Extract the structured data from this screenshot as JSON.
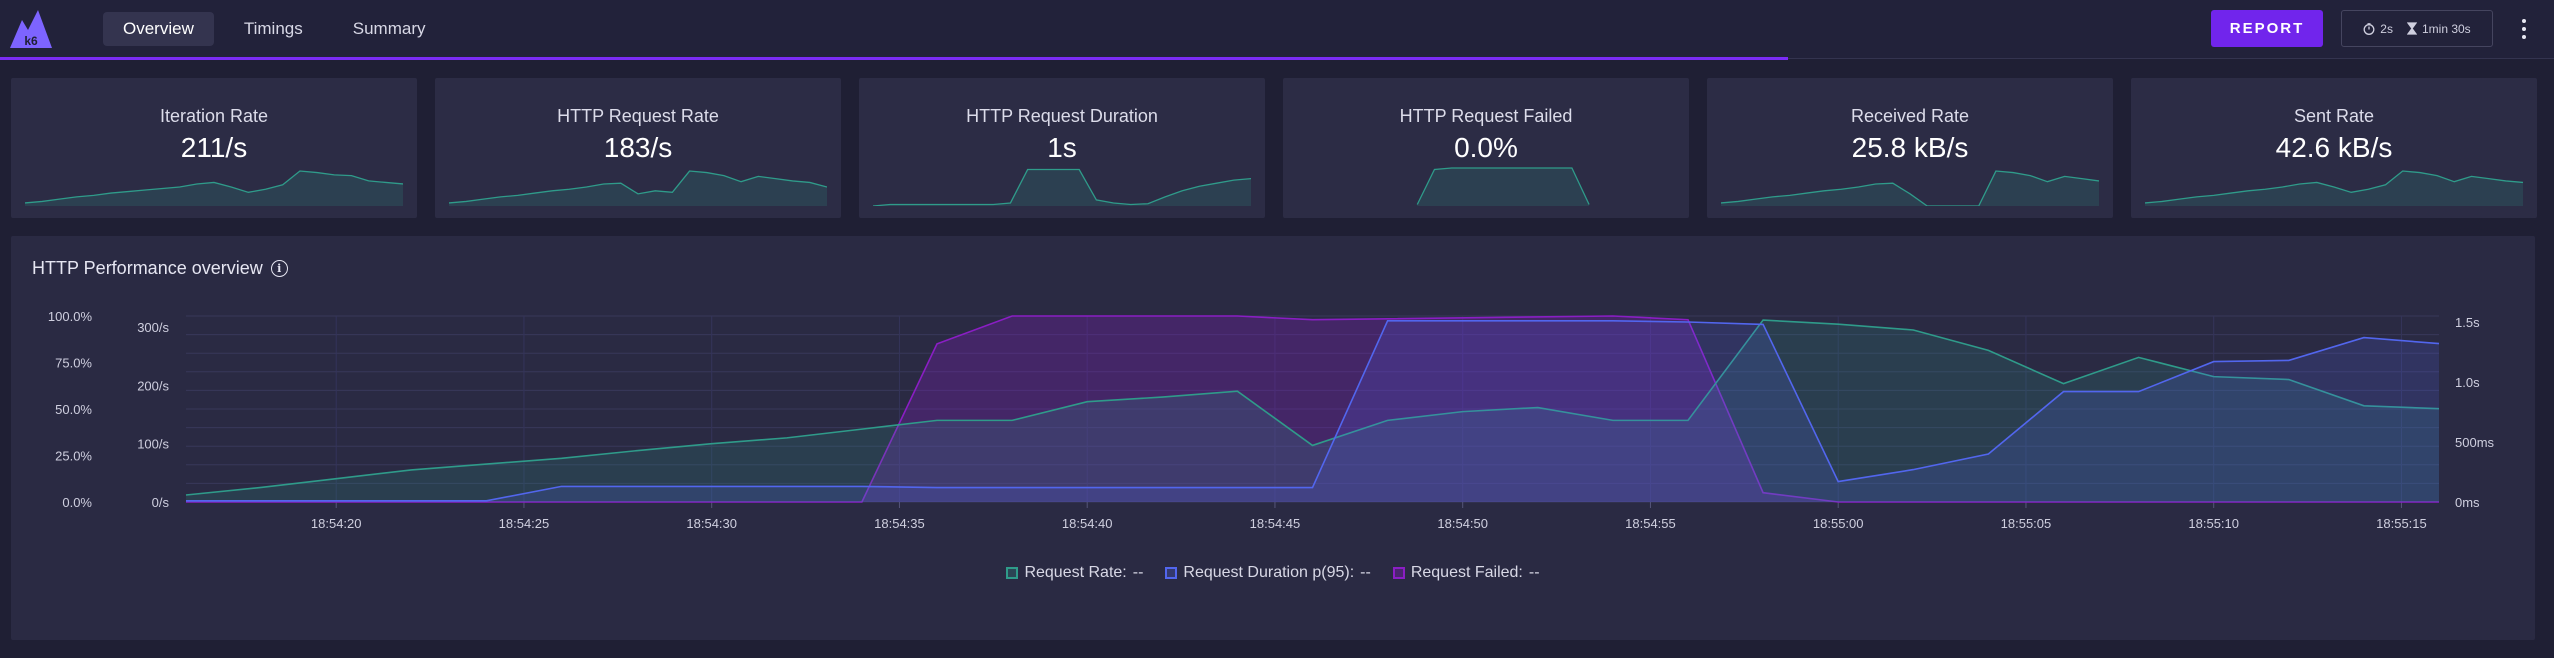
{
  "header": {
    "logo_text": "k6",
    "tabs": [
      {
        "label": "Overview",
        "active": true
      },
      {
        "label": "Timings",
        "active": false
      },
      {
        "label": "Summary",
        "active": false
      }
    ],
    "report_label": "REPORT",
    "timer": {
      "period": "2s",
      "duration": "1min 30s"
    },
    "progress_fraction": 0.7
  },
  "colors": {
    "accent": "#7125ec",
    "rate": "#2f9b8a",
    "duration": "#5266ee",
    "failed": "#8a1ec4"
  },
  "cards": [
    {
      "title": "Iteration Rate",
      "value": "211/s",
      "spark": [
        4,
        6,
        9,
        12,
        14,
        17,
        19,
        21,
        23,
        25,
        29,
        31,
        25,
        18,
        22,
        28,
        46,
        44,
        41,
        40,
        33,
        31,
        29
      ]
    },
    {
      "title": "HTTP Request Rate",
      "value": "183/s",
      "spark": [
        4,
        6,
        9,
        12,
        14,
        17,
        20,
        22,
        25,
        29,
        30,
        16,
        20,
        18,
        46,
        44,
        40,
        32,
        39,
        36,
        33,
        31,
        25
      ]
    },
    {
      "title": "HTTP Request Duration",
      "value": "1s",
      "spark": [
        0,
        2,
        2,
        2,
        2,
        2,
        2,
        2,
        4,
        48,
        48,
        48,
        48,
        8,
        4,
        2,
        3,
        12,
        20,
        26,
        30,
        34,
        36
      ]
    },
    {
      "title": "HTTP Request Failed",
      "value": "0.0%",
      "spark": [
        null,
        null,
        null,
        null,
        null,
        null,
        null,
        2,
        48,
        50,
        50,
        50,
        50,
        50,
        50,
        50,
        50,
        2,
        null,
        null,
        null,
        null,
        null
      ]
    },
    {
      "title": "Received Rate",
      "value": "25.8 kB/s",
      "spark": [
        4,
        6,
        9,
        12,
        14,
        17,
        20,
        22,
        25,
        29,
        30,
        16,
        0,
        0,
        0,
        0,
        46,
        44,
        40,
        32,
        39,
        36,
        33
      ]
    },
    {
      "title": "Sent Rate",
      "value": "42.6 kB/s",
      "spark": [
        4,
        6,
        9,
        12,
        14,
        17,
        20,
        22,
        25,
        29,
        31,
        25,
        18,
        22,
        28,
        46,
        44,
        40,
        32,
        39,
        36,
        33,
        31
      ]
    }
  ],
  "panel": {
    "title": "HTTP Performance overview",
    "legend": [
      {
        "label": "Request Rate:",
        "value": "--"
      },
      {
        "label": "Request Duration p(95):",
        "value": "--"
      },
      {
        "label": "Request Failed:",
        "value": "--"
      }
    ]
  },
  "chart_data": {
    "type": "area",
    "x_tick_labels": [
      "18:54:20",
      "18:54:25",
      "18:54:30",
      "18:54:35",
      "18:54:40",
      "18:54:45",
      "18:54:50",
      "18:54:55",
      "18:55:00",
      "18:55:05",
      "18:55:10",
      "18:55:15"
    ],
    "x_range_seconds": [
      0,
      60
    ],
    "x_ticks_seconds": [
      4,
      9,
      14,
      19,
      24,
      29,
      34,
      39,
      44,
      49,
      54,
      59
    ],
    "axes": {
      "failed_percent": {
        "ticks": [
          "0.0%",
          "25.0%",
          "50.0%",
          "75.0%",
          "100.0%"
        ],
        "range": [
          0,
          100
        ]
      },
      "rate_per_s": {
        "ticks": [
          "0/s",
          "100/s",
          "200/s",
          "300/s"
        ],
        "range": [
          0,
          319
        ]
      },
      "duration_ms": {
        "ticks": [
          "0ms",
          "500ms",
          "1.0s",
          "1.5s"
        ],
        "range": [
          0,
          1550
        ]
      }
    },
    "series": [
      {
        "name": "Request Rate",
        "axis": "rate_per_s",
        "x": [
          0,
          2,
          4,
          6,
          8,
          10,
          12,
          14,
          16,
          18,
          20,
          22,
          24,
          26,
          28,
          30,
          32,
          34,
          36,
          38,
          40,
          42,
          44,
          46,
          48,
          50,
          52,
          54,
          56,
          58,
          60
        ],
        "values": [
          12,
          25,
          40,
          55,
          65,
          75,
          88,
          100,
          110,
          125,
          140,
          140,
          172,
          180,
          190,
          97,
          140,
          155,
          162,
          140,
          140,
          312,
          305,
          295,
          260,
          203,
          248,
          215,
          210,
          165,
          160
        ]
      },
      {
        "name": "Request Duration p(95)",
        "axis": "duration_ms",
        "x": [
          0,
          8,
          10,
          18,
          20,
          28,
          30,
          32,
          38,
          40,
          42,
          44,
          46,
          48,
          50,
          52,
          54,
          56,
          58,
          60
        ],
        "values": [
          10,
          10,
          130,
          130,
          120,
          120,
          120,
          1510,
          1510,
          1500,
          1480,
          170,
          270,
          400,
          920,
          920,
          1170,
          1180,
          1370,
          1320
        ]
      },
      {
        "name": "Request Failed",
        "axis": "failed_percent",
        "x": [
          0,
          18,
          20,
          22,
          28,
          30,
          38,
          40,
          42,
          44,
          46,
          60
        ],
        "values": [
          0,
          0,
          85,
          100,
          100,
          98,
          100,
          98,
          5,
          0,
          0,
          0
        ]
      }
    ],
    "grid": true,
    "legend_position": "bottom-center"
  }
}
